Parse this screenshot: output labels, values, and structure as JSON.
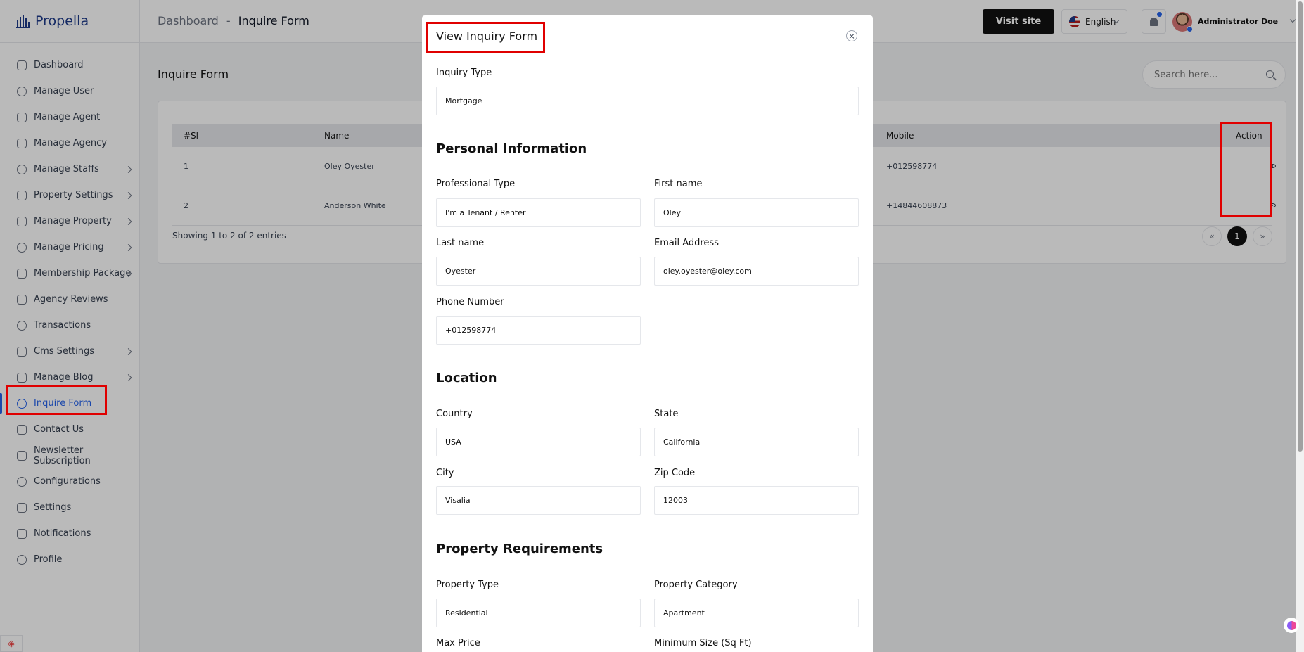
{
  "app": {
    "name": "Propella"
  },
  "sidebar": {
    "items": [
      {
        "label": "Dashboard",
        "icon": "dashboard-icon",
        "has_submenu": false
      },
      {
        "label": "Manage User",
        "icon": "user-icon",
        "has_submenu": false
      },
      {
        "label": "Manage Agent",
        "icon": "agent-icon",
        "has_submenu": false
      },
      {
        "label": "Manage Agency",
        "icon": "agency-icon",
        "has_submenu": false
      },
      {
        "label": "Manage Staffs",
        "icon": "staff-icon",
        "has_submenu": true
      },
      {
        "label": "Property Settings",
        "icon": "property-settings-icon",
        "has_submenu": true
      },
      {
        "label": "Manage Property",
        "icon": "property-icon",
        "has_submenu": true
      },
      {
        "label": "Manage Pricing",
        "icon": "pricing-icon",
        "has_submenu": true
      },
      {
        "label": "Membership Package",
        "icon": "membership-icon",
        "has_submenu": true
      },
      {
        "label": "Agency Reviews",
        "icon": "reviews-icon",
        "has_submenu": false
      },
      {
        "label": "Transactions",
        "icon": "transactions-icon",
        "has_submenu": false
      },
      {
        "label": "Cms Settings",
        "icon": "cms-icon",
        "has_submenu": true
      },
      {
        "label": "Manage Blog",
        "icon": "blog-icon",
        "has_submenu": true
      },
      {
        "label": "Inquire Form",
        "icon": "inquire-icon",
        "has_submenu": false,
        "active": true
      },
      {
        "label": "Contact Us",
        "icon": "contact-icon",
        "has_submenu": false
      },
      {
        "label": "Newsletter Subscription",
        "icon": "newsletter-icon",
        "has_submenu": false
      },
      {
        "label": "Configurations",
        "icon": "config-icon",
        "has_submenu": false
      },
      {
        "label": "Settings",
        "icon": "settings-icon",
        "has_submenu": false
      },
      {
        "label": "Notifications",
        "icon": "notifications-icon",
        "has_submenu": false
      },
      {
        "label": "Profile",
        "icon": "profile-icon",
        "has_submenu": false
      }
    ]
  },
  "topbar": {
    "breadcrumb_root": "Dashboard",
    "breadcrumb_sep": "-",
    "breadcrumb_current": "Inquire Form",
    "visit_site": "Visit site",
    "language": "English",
    "user_name": "Administrator Doe"
  },
  "page": {
    "title": "Inquire Form",
    "search_placeholder": "Search here..."
  },
  "table": {
    "headers": {
      "sl": "#Sl",
      "name": "Name",
      "mobile": "Mobile",
      "action": "Action"
    },
    "rows": [
      {
        "sl": "1",
        "name": "Oley Oyester",
        "mobile": "+012598774"
      },
      {
        "sl": "2",
        "name": "Anderson White",
        "mobile": "+14844608873"
      }
    ],
    "showing": "Showing 1 to 2 of 2 entries",
    "pagination": {
      "prev": "«",
      "current": "1",
      "next": "»"
    }
  },
  "modal": {
    "title": "View Inquiry Form",
    "inquiry_type_label": "Inquiry Type",
    "inquiry_type": "Mortgage",
    "personal_section": "Personal Information",
    "professional_type_label": "Professional Type",
    "professional_type": "I'm a Tenant / Renter",
    "first_name_label": "First name",
    "first_name": "Oley",
    "last_name_label": "Last name",
    "last_name": "Oyester",
    "email_label": "Email Address",
    "email": "oley.oyester@oley.com",
    "phone_label": "Phone Number",
    "phone": "+012598774",
    "location_section": "Location",
    "country_label": "Country",
    "country": "USA",
    "state_label": "State",
    "state": "California",
    "city_label": "City",
    "city": "Visalia",
    "zip_label": "Zip Code",
    "zip": "12003",
    "requirements_section": "Property Requirements",
    "property_type_label": "Property Type",
    "property_type": "Residential",
    "property_category_label": "Property Category",
    "property_category": "Apartment",
    "max_price_label": "Max Price",
    "min_size_label": "Minimum Size (Sq Ft)"
  },
  "colors": {
    "accent": "#2563eb",
    "highlight": "#e00000",
    "dark_button": "#111111"
  }
}
